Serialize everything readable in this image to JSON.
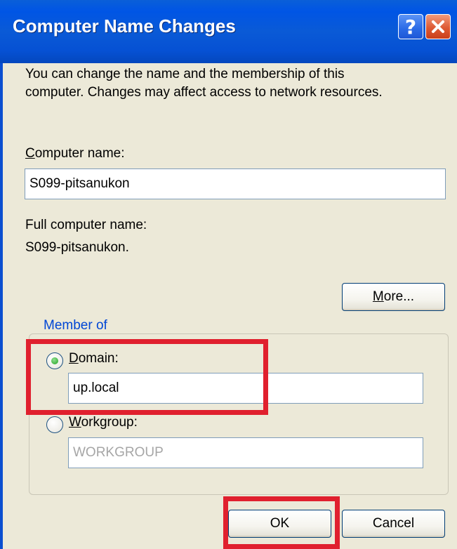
{
  "window": {
    "title": "Computer Name Changes",
    "help_glyph": "?",
    "colors": {
      "titlebar": "#0055e5",
      "face": "#ece9d8",
      "group_label": "#0046d5",
      "highlight": "#e0202e"
    }
  },
  "dialog": {
    "description_line1": "You can change the name and the membership of this",
    "description_line2": "computer. Changes may affect access to network resources.",
    "computer_name_label_first": "C",
    "computer_name_label_rest": "omputer name:",
    "computer_name_value": "S099-pitsanukon",
    "full_name_label": "Full computer name:",
    "full_name_value": "S099-pitsanukon.",
    "more_button_first": "M",
    "more_button_rest": "ore...",
    "member_of_label": "Member of",
    "domain_label_first": "D",
    "domain_label_rest": "omain:",
    "domain_selected": true,
    "domain_value": "up.local",
    "workgroup_label_first": "W",
    "workgroup_label_rest": "orkgroup:",
    "workgroup_selected": false,
    "workgroup_value": "WORKGROUP",
    "ok_button": "OK",
    "cancel_button": "Cancel"
  }
}
